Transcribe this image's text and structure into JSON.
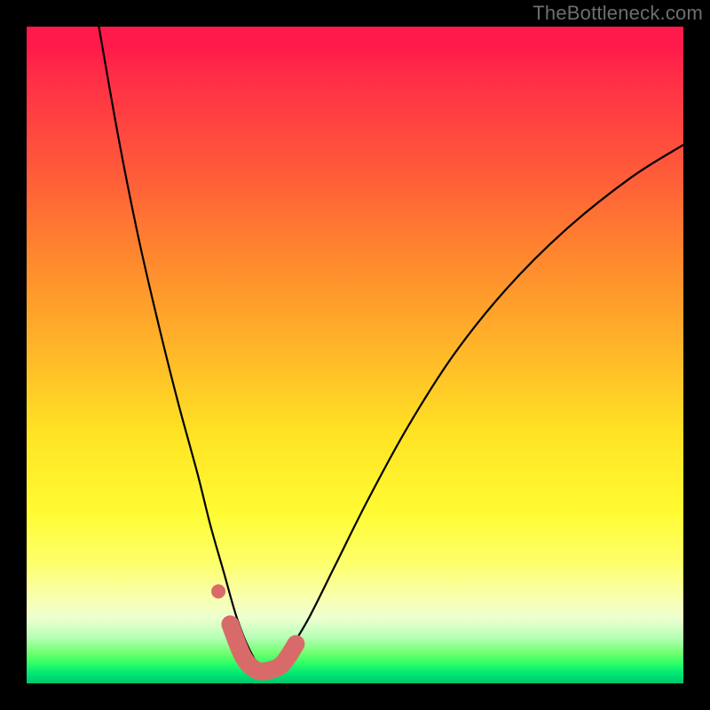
{
  "watermark": "TheBottleneck.com",
  "colors": {
    "background": "#000000",
    "curve_stroke": "#000000",
    "marker_stroke": "#d86b6a",
    "marker_fill": "#d86b6a"
  },
  "chart_data": {
    "type": "line",
    "title": "",
    "xlabel": "",
    "ylabel": "",
    "xlim": [
      0,
      100
    ],
    "ylim": [
      0,
      100
    ],
    "grid": false,
    "legend": false,
    "description": "Bottleneck curve: V-shaped black curve over a red-to-green vertical gradient. Minimum (optimal balance, ~0% bottleneck) occurs near x≈36. Short salmon-colored segment and dot highlight the region around the minimum.",
    "series": [
      {
        "name": "bottleneck-curve",
        "x": [
          11,
          14,
          17,
          20,
          23,
          26,
          28,
          30,
          32,
          34,
          36,
          38,
          40,
          43,
          47,
          52,
          58,
          65,
          73,
          82,
          92,
          100
        ],
        "values": [
          100,
          83,
          68,
          55,
          43,
          32,
          24,
          17,
          10,
          5,
          2,
          2,
          5,
          10,
          18,
          28,
          39,
          50,
          60,
          69,
          77,
          82
        ]
      },
      {
        "name": "highlight-segment",
        "x": [
          31,
          33,
          35,
          37,
          39,
          41
        ],
        "values": [
          9,
          4,
          2,
          2,
          3,
          6
        ]
      }
    ],
    "markers": [
      {
        "name": "highlight-dot",
        "x": 29.2,
        "y": 14
      }
    ]
  }
}
